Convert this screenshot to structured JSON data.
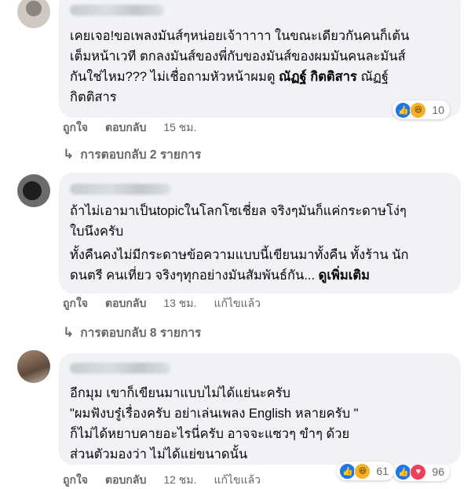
{
  "comments": [
    {
      "text_lines": [
        "เคยเจอ!ขอเพลงมันส์ๆหน่อยเจ้าาาาา ในขณะเดียวกันคนก็เต้น",
        "เต็มหน้าเวที ตกลงมันส์ของพี่กับของมันส์ของผมมันคนละมันส์"
      ],
      "text_line3_pre": "กันใช่ไหม??? ไม่เชื่อถามหัวหน้าผมดู ",
      "mention_bold": "ณัฏฐ์ กิตติสาร",
      "text_line3_post": " ณัฏฐ์",
      "text_line4": "กิตติสาร",
      "like_label": "ถูกใจ",
      "reply_label": "ตอบกลับ",
      "time": "15 ชม.",
      "reaction_count": "10",
      "replies_label": "การตอบกลับ 2 รายการ"
    },
    {
      "para1": [
        "ถ้าไม่เอามาเป็นtopicในโลกโซเชี่ยล จริงๆมันก็แค่กระดาษโง่ๆ",
        "ใบนึงครับ"
      ],
      "para2_line1": "ทั้งคืนคงไม่มีกระดาษข้อความแบบนี้เขียนมาทั้งคืน ทั้งร้าน นัก",
      "para2_line2": "ดนตรี คนเที่ยว จริงๆทุกอย่างมันสัมพันธ์กัน... ",
      "see_more": "ดูเพิ่มเติม",
      "like_label": "ถูกใจ",
      "reply_label": "ตอบกลับ",
      "time": "13 ชม.",
      "edited": "แก้ไขแล้ว",
      "reaction_count": "96",
      "replies_label": "การตอบกลับ 8 รายการ"
    },
    {
      "text_lines": [
        "อีกมุม เขาก็เขียนมาแบบไม่ได้แย่นะครับ",
        "\"ผมฟังบรู๋เรื่องครับ อย่าเล่นเพลง English หลายครับ \"",
        "ก็ไม่ได้หยาบคายอะไรนี่ครับ อาจจะแซวๆ ขำๆ ด้วย",
        "ส่วนตัวมองว่า ไม่ได้แย่ขนาดนั้น"
      ],
      "like_label": "ถูกใจ",
      "reply_label": "ตอบกลับ",
      "time": "12 ชม.",
      "edited": "แก้ไขแล้ว",
      "reaction_count": "61"
    }
  ],
  "icons": {
    "reply_arrow": "↳",
    "like": "👍",
    "haha": "😆",
    "love": "♥"
  },
  "colors": {
    "bubble": "#f0f2f5",
    "meta_text": "#65676b",
    "like_blue": "#1877f2",
    "love_red": "#f33e58",
    "haha_yellow": "#f7b125"
  }
}
